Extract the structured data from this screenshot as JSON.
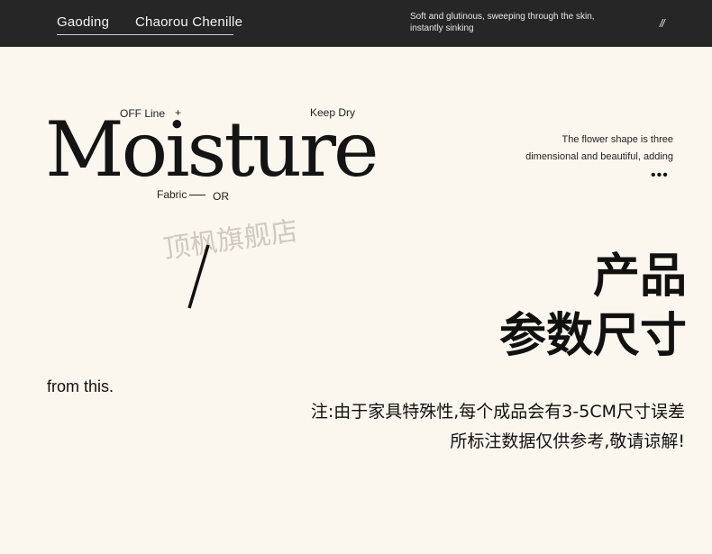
{
  "topbar": {
    "brand_a": "Gaoding",
    "brand_b": "Chaorou Chenille",
    "tagline": "Soft and glutinous, sweeping through the skin, instantly sinking",
    "slashes": "//"
  },
  "moisture": {
    "off_line": "OFF Line",
    "plus": "+",
    "keep_dry": "Keep Dry",
    "title": "Moisture",
    "fabric": "Fabric",
    "or": "OR"
  },
  "description": {
    "line1": "The flower shape is three",
    "line2": "dimensional and beautiful, adding",
    "dots": "•••"
  },
  "watermark": "顶枫旗舰店",
  "heading": {
    "line1": "产品",
    "line2": "参数尺寸"
  },
  "from_this": "from this.",
  "note": {
    "line1": "注:由于家具特殊性,每个成品会有3-5CM尺寸误差",
    "line2": "所标注数据仅供参考,敬请谅解!"
  },
  "colors": {
    "background": "#fbf6ee",
    "topbar": "#262626",
    "text": "#111111",
    "watermark": "#cfc9c0"
  }
}
